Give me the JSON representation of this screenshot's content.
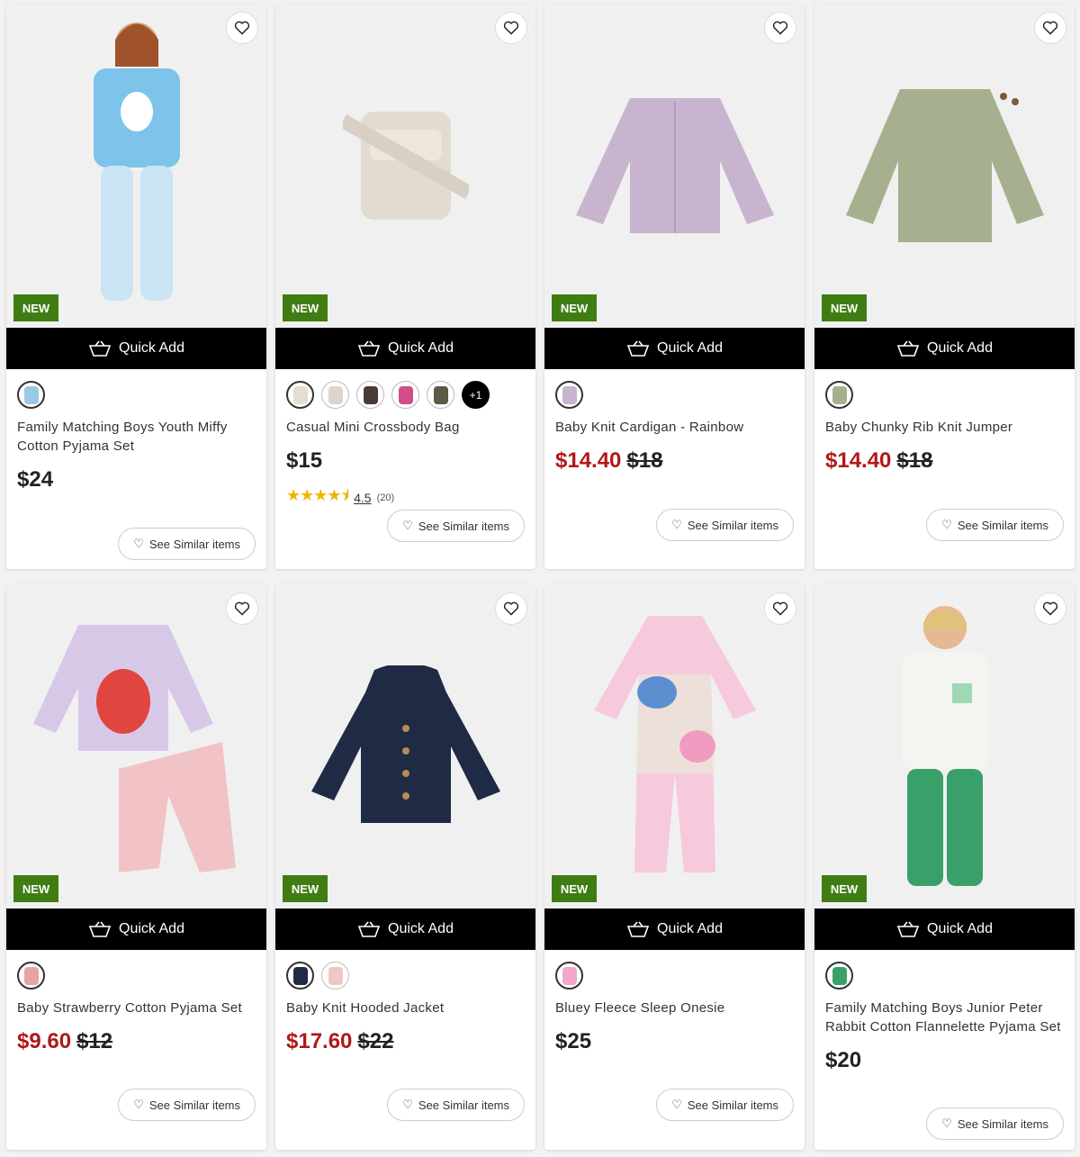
{
  "quick_add_label": "Quick Add",
  "new_label": "NEW",
  "see_similar_label": "See Similar items",
  "colors": {
    "new_badge": "#3f7d12",
    "sale_price": "#b01818",
    "quick_add_bg": "#000000"
  },
  "products": [
    {
      "name": "Family Matching Boys Youth Miffy Cotton Pyjama Set",
      "price": "$24",
      "sale_price": null,
      "was_price": null,
      "swatches": [
        "#9cc8e6"
      ],
      "more": null
    },
    {
      "name": "Casual Mini Crossbody Bag",
      "price": "$15",
      "sale_price": null,
      "was_price": null,
      "swatches": [
        "#e5ddd0",
        "#ddd6c8",
        "#4a3a35",
        "#d54c8a",
        "#5a5a45"
      ],
      "more": "+1",
      "rating": "4.5",
      "rating_count": "(20)",
      "rating_stars": 4.5
    },
    {
      "name": "Baby Knit Cardigan - Rainbow",
      "price": null,
      "sale_price": "$14.40",
      "was_price": "$18",
      "swatches": [
        "#c9b4cf"
      ],
      "more": null
    },
    {
      "name": "Baby Chunky Rib Knit Jumper",
      "price": null,
      "sale_price": "$14.40",
      "was_price": "$18",
      "swatches": [
        "#a7b08e"
      ],
      "more": null
    },
    {
      "name": "Baby Strawberry Cotton Pyjama Set",
      "price": null,
      "sale_price": "$9.60",
      "was_price": "$12",
      "swatches": [
        "#e8a2a8"
      ],
      "more": null
    },
    {
      "name": "Baby Knit Hooded Jacket",
      "price": null,
      "sale_price": "$17.60",
      "was_price": "$22",
      "swatches": [
        "#1f2a44",
        "#f0c6c8"
      ],
      "more": null
    },
    {
      "name": "Bluey Fleece Sleep Onesie",
      "price": "$25",
      "sale_price": null,
      "was_price": null,
      "swatches": [
        "#f2a8c8"
      ],
      "more": null
    },
    {
      "name": "Family Matching Boys Junior Peter Rabbit Cotton Flannelette Pyjama Set",
      "price": "$20",
      "sale_price": null,
      "was_price": null,
      "swatches": [
        "#3aa06a"
      ],
      "more": null
    }
  ]
}
